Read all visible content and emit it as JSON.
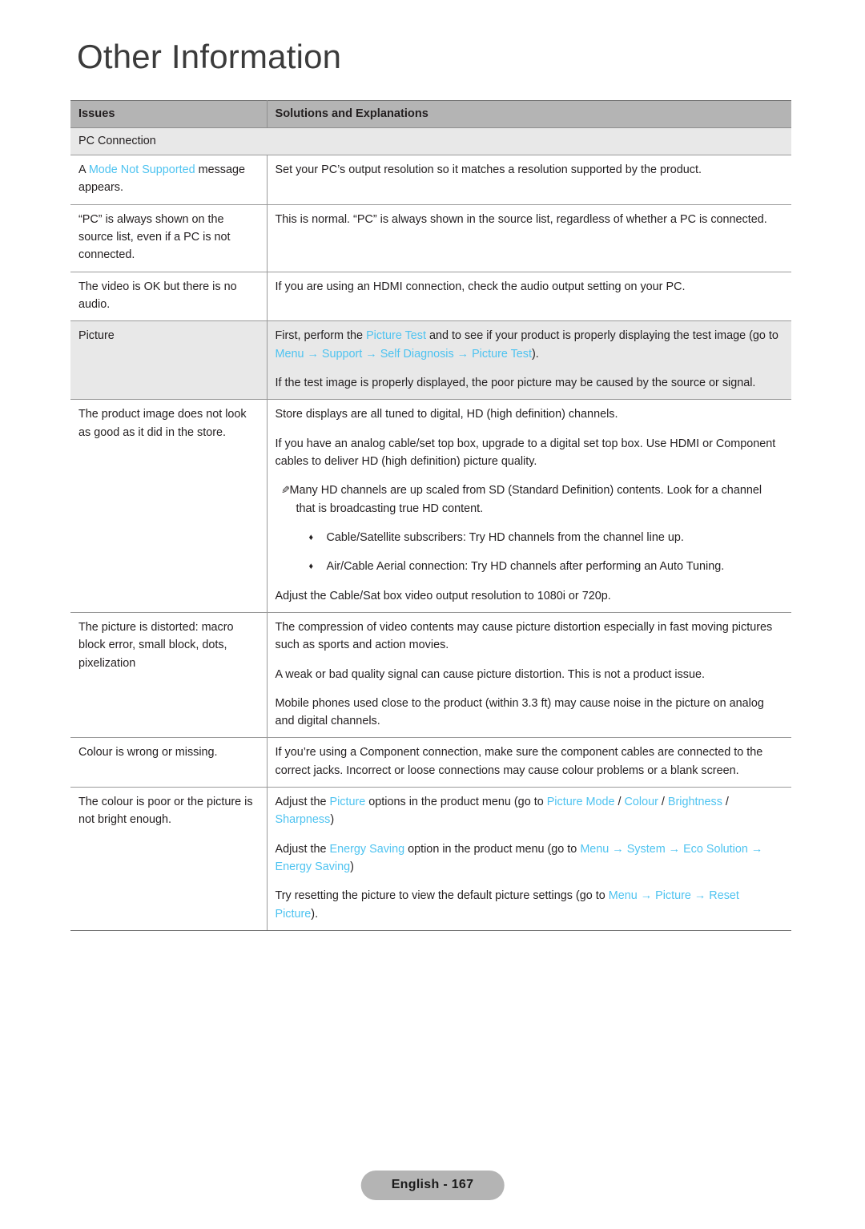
{
  "page": {
    "title": "Other Information",
    "footer_label": "English - 167"
  },
  "colors": {
    "link_blue": "#4ec3f0",
    "header_band": "#b4b4b4",
    "section_band": "#e8e8e8",
    "text": "#231f20"
  },
  "icons": {
    "note_glyph": "✎",
    "bullet_glyph": "♦",
    "arrow_glyph": "→"
  },
  "table": {
    "columns": [
      "Issues",
      "Solutions and Explanations"
    ],
    "section_label": "PC Connection",
    "rows": [
      {
        "issue_parts": [
          {
            "t": "A ",
            "link": false
          },
          {
            "t": "Mode Not Supported",
            "link": true
          },
          {
            "t": " message appears.",
            "link": false
          }
        ],
        "solution_paragraphs": [
          {
            "parts": [
              {
                "t": "Set your PC’s output resolution so it matches a resolution supported by the product.",
                "link": false
              }
            ]
          }
        ]
      },
      {
        "issue_parts": [
          {
            "t": "“PC” is always shown on the source list, even if a PC is not connected.",
            "link": false
          }
        ],
        "solution_paragraphs": [
          {
            "parts": [
              {
                "t": "This is normal. “PC” is always shown in the source list, regardless of whether a PC is connected.",
                "link": false
              }
            ]
          }
        ]
      },
      {
        "issue_parts": [
          {
            "t": "The video is OK but there is no audio.",
            "link": false
          }
        ],
        "solution_paragraphs": [
          {
            "parts": [
              {
                "t": "If you are using an HDMI connection, check the audio output setting on your PC.",
                "link": false
              }
            ]
          }
        ]
      },
      {
        "shaded": true,
        "issue_parts": [
          {
            "t": "Picture",
            "link": false
          }
        ],
        "solution_paragraphs": [
          {
            "parts": [
              {
                "t": "First, perform the ",
                "link": false
              },
              {
                "t": "Picture Test",
                "link": true
              },
              {
                "t": " and to see if your product is properly displaying the test image (go to ",
                "link": false
              },
              {
                "t": "Menu",
                "link": true
              },
              {
                "t": " → ",
                "link": true
              },
              {
                "t": "Support",
                "link": true
              },
              {
                "t": " → ",
                "link": true
              },
              {
                "t": "Self Diagnosis",
                "link": true
              },
              {
                "t": " → ",
                "link": true
              },
              {
                "t": "Picture Test",
                "link": true
              },
              {
                "t": ").",
                "link": false
              }
            ]
          },
          {
            "parts": [
              {
                "t": "If the test image is properly displayed, the poor picture may be caused by the source or signal.",
                "link": false
              }
            ]
          }
        ]
      },
      {
        "issue_parts": [
          {
            "t": "The product image does not look as good as it did in the store.",
            "link": false
          }
        ],
        "solution_paragraphs": [
          {
            "parts": [
              {
                "t": "Store displays are all tuned to digital, HD (high definition) channels.",
                "link": false
              }
            ]
          },
          {
            "parts": [
              {
                "t": "If you have an analog cable/set top box, upgrade to a digital set top box. Use HDMI or Component cables to deliver HD (high definition) picture quality.",
                "link": false
              }
            ]
          },
          {
            "style": "note",
            "parts": [
              {
                "t": "Many HD channels are up scaled from SD (Standard Definition) contents. Look for a channel that is broadcasting true HD content.",
                "link": false
              }
            ]
          },
          {
            "style": "bullet",
            "parts": [
              {
                "t": "Cable/Satellite subscribers: Try HD channels from the channel line up.",
                "link": false
              }
            ]
          },
          {
            "style": "bullet",
            "parts": [
              {
                "t": "Air/Cable Aerial connection: Try HD channels after performing an Auto Tuning.",
                "link": false
              }
            ]
          },
          {
            "parts": [
              {
                "t": "Adjust the Cable/Sat box video output resolution to 1080i or 720p.",
                "link": false
              }
            ]
          }
        ]
      },
      {
        "issue_parts": [
          {
            "t": "The picture is distorted: macro block error, small block, dots, pixelization",
            "link": false
          }
        ],
        "solution_paragraphs": [
          {
            "parts": [
              {
                "t": "The compression of video contents may cause picture distortion especially in fast moving pictures such as sports and action movies.",
                "link": false
              }
            ]
          },
          {
            "parts": [
              {
                "t": "A weak or bad quality signal can cause picture distortion. This is not a product issue.",
                "link": false
              }
            ]
          },
          {
            "parts": [
              {
                "t": "Mobile phones used close to the product (within 3.3 ft) may cause noise in the picture on analog and digital channels.",
                "link": false
              }
            ]
          }
        ]
      },
      {
        "issue_parts": [
          {
            "t": "Colour is wrong or missing.",
            "link": false
          }
        ],
        "solution_paragraphs": [
          {
            "parts": [
              {
                "t": "If you’re using a Component connection, make sure the component cables are connected to the correct jacks. Incorrect or loose connections may cause colour problems or a blank screen.",
                "link": false
              }
            ]
          }
        ]
      },
      {
        "last": true,
        "issue_parts": [
          {
            "t": "The colour is poor or the picture is not bright enough.",
            "link": false
          }
        ],
        "solution_paragraphs": [
          {
            "parts": [
              {
                "t": "Adjust the ",
                "link": false
              },
              {
                "t": "Picture",
                "link": true
              },
              {
                "t": " options in the product menu (go to ",
                "link": false
              },
              {
                "t": "Picture Mode",
                "link": true
              },
              {
                "t": " / ",
                "link": false
              },
              {
                "t": "Colour",
                "link": true
              },
              {
                "t": " / ",
                "link": false
              },
              {
                "t": "Brightness",
                "link": true
              },
              {
                "t": " / ",
                "link": false
              },
              {
                "t": "Sharpness",
                "link": true
              },
              {
                "t": ")",
                "link": false
              }
            ]
          },
          {
            "parts": [
              {
                "t": "Adjust the ",
                "link": false
              },
              {
                "t": "Energy Saving",
                "link": true
              },
              {
                "t": " option in the product menu (go to ",
                "link": false
              },
              {
                "t": "Menu",
                "link": true
              },
              {
                "t": " → ",
                "link": true
              },
              {
                "t": "System",
                "link": true
              },
              {
                "t": " → ",
                "link": true
              },
              {
                "t": "Eco Solution",
                "link": true
              },
              {
                "t": " → ",
                "link": true
              },
              {
                "t": "Energy Saving",
                "link": true
              },
              {
                "t": ")",
                "link": false
              }
            ]
          },
          {
            "parts": [
              {
                "t": "Try resetting the picture to view the default picture settings (go to ",
                "link": false
              },
              {
                "t": "Menu",
                "link": true
              },
              {
                "t": " → ",
                "link": true
              },
              {
                "t": "Picture",
                "link": true
              },
              {
                "t": " → ",
                "link": true
              },
              {
                "t": "Reset Picture",
                "link": true
              },
              {
                "t": ").",
                "link": false
              }
            ]
          }
        ]
      }
    ]
  }
}
